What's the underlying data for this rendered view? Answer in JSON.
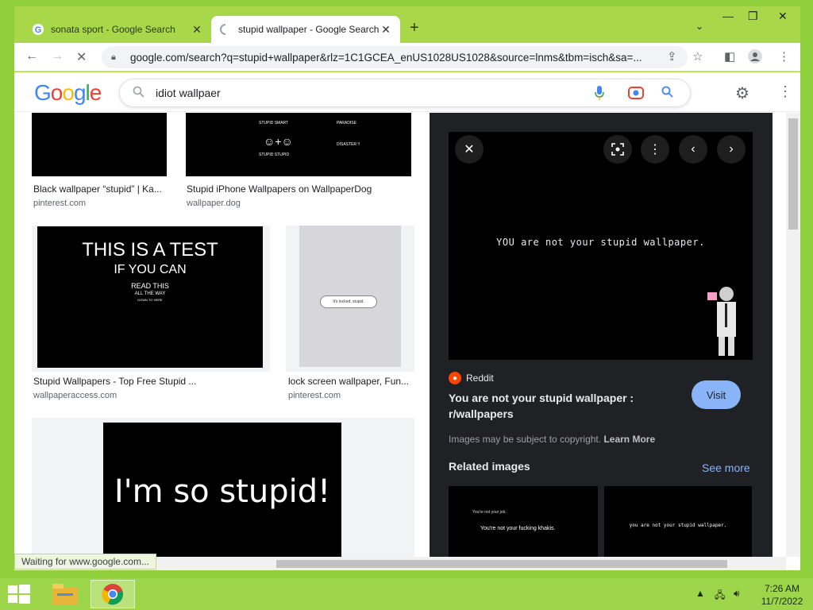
{
  "tabs": [
    {
      "title": "sonata sport - Google Search",
      "active": false
    },
    {
      "title": "stupid wallpaper - Google Search",
      "active": true
    }
  ],
  "address": {
    "url": "google.com/search?q=stupid+wallpaper&rlz=1C1GCEA_enUS1028US1028&source=lnms&tbm=isch&sa=..."
  },
  "search": {
    "query": "idiot wallpaer"
  },
  "logo": {
    "text": "Google"
  },
  "results": [
    {
      "title": "Black wallpaper “stupid” | Ka...",
      "source": "pinterest.com"
    },
    {
      "title": "Stupid iPhone Wallpapers on WallpaperDog",
      "source": "wallpaper.dog",
      "lines": [
        "STUPID SMART",
        "PARADISE",
        "STUPID STUPID",
        "DISASTER !!"
      ]
    },
    {
      "title": "Stupid Wallpapers - Top Free Stupid ...",
      "source": "wallpaperaccess.com",
      "lines": [
        "THIS IS A TEST",
        "IF YOU CAN",
        "READ THIS",
        "ALL THE WAY",
        "DOWN TO HERE"
      ]
    },
    {
      "title": "lock screen wallpaper, Fun...",
      "source": "pinterest.com",
      "bubble": "It's locked, stupid."
    },
    {
      "big_text": "I'm so stupid!"
    }
  ],
  "preview": {
    "image_text": "YOU are not your stupid wallpaper.",
    "source": "Reddit",
    "title": "You are not your stupid wallpaper : r/wallpapers",
    "visit": "Visit",
    "copyright": "Images may be subject to copyright.",
    "learn_more": "Learn More",
    "related": "Related images",
    "see_more": "See more",
    "related_1_lines": [
      "You're not your job.",
      "You're not your fucking khakis."
    ],
    "related_2_text": "you are not your stupid wallpaper."
  },
  "status": {
    "text": "Waiting for www.google.com..."
  },
  "clock": {
    "time": "7:26 AM",
    "date": "11/7/2022"
  }
}
